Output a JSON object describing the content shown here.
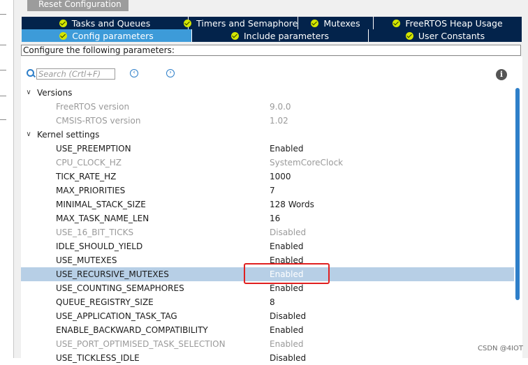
{
  "toolbar": {
    "reset_label": "Reset Configuration"
  },
  "tabs_row1": [
    {
      "label": "Tasks and Queues"
    },
    {
      "label": "Timers and Semaphores"
    },
    {
      "label": "Mutexes"
    },
    {
      "label": "FreeRTOS Heap Usage"
    }
  ],
  "tabs_row2": [
    {
      "label": "Config parameters",
      "active": true
    },
    {
      "label": "Include parameters"
    },
    {
      "label": "User Constants"
    }
  ],
  "configure_label": "Configure the following parameters:",
  "search": {
    "placeholder": "Search (Crtl+F)"
  },
  "groups": {
    "versions": {
      "label": "Versions",
      "rows": [
        {
          "name": "FreeRTOS version",
          "value": "9.0.0"
        },
        {
          "name": "CMSIS-RTOS version",
          "value": "1.02"
        }
      ]
    },
    "kernel": {
      "label": "Kernel settings",
      "rows": [
        {
          "name": "USE_PREEMPTION",
          "value": "Enabled"
        },
        {
          "name": "CPU_CLOCK_HZ",
          "value": "SystemCoreClock"
        },
        {
          "name": "TICK_RATE_HZ",
          "value": "1000"
        },
        {
          "name": "MAX_PRIORITIES",
          "value": "7"
        },
        {
          "name": "MINIMAL_STACK_SIZE",
          "value": "128 Words"
        },
        {
          "name": "MAX_TASK_NAME_LEN",
          "value": "16"
        },
        {
          "name": "USE_16_BIT_TICKS",
          "value": "Disabled"
        },
        {
          "name": "IDLE_SHOULD_YIELD",
          "value": "Enabled"
        },
        {
          "name": "USE_MUTEXES",
          "value": "Enabled"
        },
        {
          "name": "USE_RECURSIVE_MUTEXES",
          "value": "Enabled"
        },
        {
          "name": "USE_COUNTING_SEMAPHORES",
          "value": "Enabled"
        },
        {
          "name": "QUEUE_REGISTRY_SIZE",
          "value": "8"
        },
        {
          "name": "USE_APPLICATION_TASK_TAG",
          "value": "Disabled"
        },
        {
          "name": "ENABLE_BACKWARD_COMPATIBILITY",
          "value": "Enabled"
        },
        {
          "name": "USE_PORT_OPTIMISED_TASK_SELECTION",
          "value": "Enabled"
        },
        {
          "name": "USE_TICKLESS_IDLE",
          "value": "Disabled"
        }
      ]
    }
  },
  "watermark": "CSDN @4IOT",
  "colors": {
    "tab_bg": "#03234b",
    "tab_active": "#3d9bd9",
    "check": "#d4e600",
    "selection": "#b7cfe6",
    "highlight": "#e02020"
  }
}
